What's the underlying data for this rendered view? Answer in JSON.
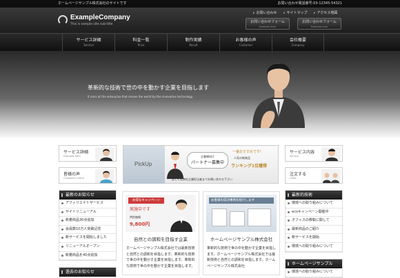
{
  "topbar": {
    "left_text": "ホームページサンプル株式会社のサイトです",
    "right_text": "お問い合わせ電話番号:03-12345-54321"
  },
  "header": {
    "company_name": "ExampleCompany",
    "tagline": "This is sample site sub-title",
    "util_links": [
      "お問い合わせ",
      "サイトマップ",
      "アクセス地図"
    ],
    "buttons": [
      {
        "label": "お問い合わせフォーム",
        "sub": "Estimate form"
      },
      {
        "label": "お問い合わせフォーム",
        "sub": "Estimate form"
      }
    ]
  },
  "nav": [
    {
      "label": "サービス詳細",
      "sub": "Service"
    },
    {
      "label": "料金一覧",
      "sub": "Price"
    },
    {
      "label": "制作実績",
      "sub": "Result"
    },
    {
      "label": "お客様の声",
      "sub": "Customer"
    },
    {
      "label": "会社概要",
      "sub": "Company"
    }
  ],
  "hero": {
    "catch": "革新的な技術で世の中を動かす企業を目指します",
    "sub": "It aims at the enterprise that moves the world by the innovative technology."
  },
  "side_buttons_left": [
    {
      "title": "サービス詳細",
      "sub": "Estimate form"
    },
    {
      "title": "皆様の声",
      "sub": "Customer's Voice"
    }
  ],
  "side_buttons_right": [
    {
      "title": "サービス内容",
      "sub": "Service"
    },
    {
      "title": "注文する",
      "sub": "Order"
    }
  ],
  "pickup": {
    "label": "PickUp",
    "bubble_small": "企業様向け",
    "bubble_main": "パートナー募集中",
    "right_top": "一番おすすめです!",
    "right_badge": "人気の新商品",
    "right_rank": "ランキング1位獲得",
    "footer_text": "詳しくは弊社企業担当者までお問い合わせ下さい"
  },
  "left_news": {
    "title": "最新のお知らせ",
    "items": [
      "アフィリエイトサービス",
      "サイトリニューアル",
      "新着商品30点追加",
      "会員数10万人突破記念",
      "新サービスを開始しました",
      "リニューアルオープン",
      "新着商品を40点追加"
    ]
  },
  "left_past": {
    "title": "過去のお知らせ"
  },
  "right_tech": {
    "title": "最新的技術",
    "items": [
      "環境への取り組みについて",
      "ecoキャンペーン開催中",
      "オフィスの移転に関して",
      "最新商品のご紹介",
      "新サービスを開始",
      "環境への取り組みについて"
    ]
  },
  "right_hp": {
    "title": "ホームページサンプル",
    "items": [
      "環境への取り組みについて"
    ]
  },
  "cards": [
    {
      "img_top": "お得なキャンペーン",
      "img_mid": "実施中です",
      "img_small": "特別価格",
      "img_price": "9,800円",
      "title": "自然との調和を目指す企業",
      "text": "ホームページサンプル株式会社では最新技術と自然との調和を目指します。革新的な技術で世の中を動かす企業を目指します。革新的な技術で世の中を動かす企業を目指します。"
    },
    {
      "img_top": "お客様の成功事例を紹介します",
      "title": "ホームページサンプル株式会社",
      "text": "革新的な技術で世の中を動かす企業を目指します。ホームページサンプル株式会社では最新技術と自然との調和を目指します。ホームページサンプル株式会社"
    }
  ],
  "colors": {
    "header_dark": "#1e1e1e",
    "accent_red": "#cc3b3b",
    "nav_bg": "#101010"
  }
}
